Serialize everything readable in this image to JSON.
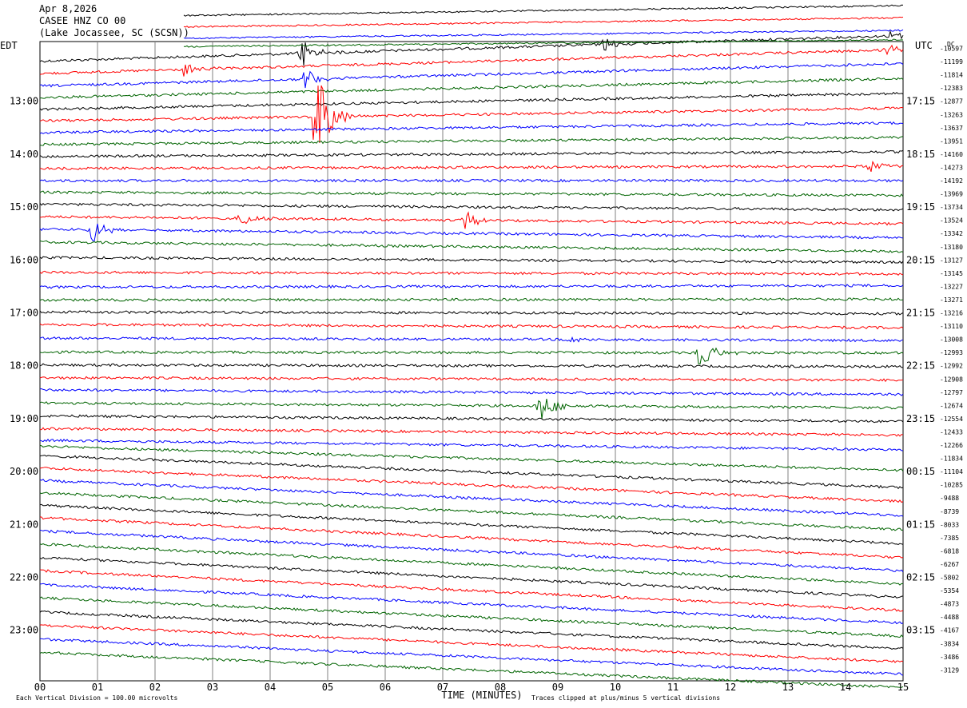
{
  "header": {
    "date": "Apr 8,2026",
    "station": "CASEE HNZ CO 00",
    "location": "(Lake Jocassee, SC (SCSN))"
  },
  "chart_data": {
    "type": "line",
    "title": "CASEE HNZ CO 00",
    "left_timezone": "EDT",
    "right_timezone": "UTC",
    "dc_label": "DC",
    "xlabel": "TIME (MINUTES)",
    "x_ticks": [
      "00",
      "01",
      "02",
      "03",
      "04",
      "05",
      "06",
      "07",
      "08",
      "09",
      "10",
      "11",
      "12",
      "13",
      "14",
      "15"
    ],
    "xlim": [
      0,
      15
    ],
    "left_hour_labels": [
      "13:00",
      "14:00",
      "15:00",
      "16:00",
      "17:00",
      "18:00",
      "19:00",
      "20:00",
      "21:00",
      "22:00",
      "23:00"
    ],
    "right_hour_labels": [
      "17:15",
      "18:15",
      "19:15",
      "20:15",
      "21:15",
      "22:15",
      "23:15",
      "00:15",
      "01:15",
      "02:15",
      "03:15"
    ],
    "dc_offsets": [
      "-10597",
      "-11199",
      "-11814",
      "-12383",
      "-12877",
      "-13263",
      "-13637",
      "-13951",
      "-14160",
      "-14273",
      "-14192",
      "-13969",
      "-13734",
      "-13524",
      "-13342",
      "-13180",
      "-13127",
      "-13145",
      "-13227",
      "-13271",
      "-13216",
      "-13110",
      "-13008",
      "-12993",
      "-12992",
      "-12908",
      "-12797",
      "-12674",
      "-12554",
      "-12433",
      "-12266",
      "-11834",
      "-11104",
      "-10285",
      "-9488",
      "-8739",
      "-8033",
      "-7385",
      "-6818",
      "-6267",
      "-5802",
      "-5354",
      "-4873",
      "-4488",
      "-4167",
      "-3834",
      "-3486",
      "-3129"
    ],
    "trace_colors": [
      "#000000",
      "#ff0000",
      "#0000ff",
      "#006400"
    ],
    "trace_count": 48,
    "trace_slopes": [
      -3.2,
      -3.0,
      -2.8,
      -2.4,
      -2.0,
      -1.6,
      -1.2,
      -0.9,
      -0.6,
      -0.3,
      0.0,
      0.4,
      0.7,
      0.9,
      1.1,
      1.2,
      0.6,
      0.2,
      -0.2,
      -0.1,
      0.2,
      0.4,
      0.3,
      0.1,
      0.2,
      0.3,
      0.6,
      0.6,
      0.7,
      0.8,
      1.2,
      3.0,
      4.0,
      4.2,
      4.4,
      4.6,
      4.8,
      5.0,
      5.0,
      5.0,
      5.0,
      5.0,
      4.8,
      4.8,
      4.6,
      4.6,
      4.4,
      4.4
    ],
    "events": [
      {
        "trace": 0,
        "minute": 9.8,
        "amplitude": 10
      },
      {
        "trace": 1,
        "minute": 2.5,
        "amplitude": 12
      },
      {
        "trace": 0,
        "minute": 4.55,
        "amplitude": 22
      },
      {
        "trace": 2,
        "minute": 4.6,
        "amplitude": 14
      },
      {
        "trace": 0,
        "minute": 14.8,
        "amplitude": 10
      },
      {
        "trace": 5,
        "minute": 4.8,
        "amplitude": 75
      },
      {
        "trace": 1,
        "minute": 14.7,
        "amplitude": 8
      },
      {
        "trace": 9,
        "minute": 14.4,
        "amplitude": 8
      },
      {
        "trace": 14,
        "minute": 0.9,
        "amplitude": 18
      },
      {
        "trace": 13,
        "minute": 3.5,
        "amplitude": 12
      },
      {
        "trace": 13,
        "minute": 7.4,
        "amplitude": 14
      },
      {
        "trace": 23,
        "minute": 11.45,
        "amplitude": 28
      },
      {
        "trace": 22,
        "minute": 9.2,
        "amplitude": 6
      },
      {
        "trace": 27,
        "minute": 8.7,
        "amplitude": 22
      }
    ],
    "footer_left": "Each Vertical Division =  100.00 microvolts",
    "footer_right": "Traces clipped at plus/minus 5 vertical divisions"
  }
}
